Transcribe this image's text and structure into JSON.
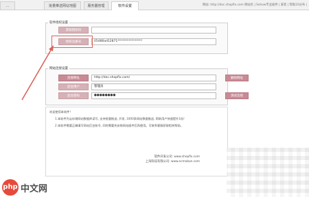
{
  "tabs": [
    {
      "label": "…",
      "active": false
    },
    {
      "label": "批量推送网站地图",
      "active": false
    },
    {
      "label": "服务器管理",
      "active": false
    },
    {
      "label": "软件设置",
      "active": true
    }
  ],
  "header_note": "网站: http://doc.shopfix.com 网站名 | Sohow专业插件 | 安装 | 帮助10分布 |",
  "auth": {
    "title": "软件授权设置",
    "get_code_label": "获取授权码",
    "register_label": "授权注册号",
    "machine_value": "",
    "code_value": "05486ad12871****************"
  },
  "site": {
    "title": "网站连接设置",
    "url_label": "连接网址",
    "user_label": "后台用户",
    "pass_label": "后台密码",
    "url_value": "http://doc.shopfix.com/",
    "user_value": "管理员",
    "pass_value": "●●●●●●●●",
    "delete_label": "删除网址",
    "test_label": "测试连接"
  },
  "notes": {
    "intro": "欢迎使用本软件!",
    "line1": "1.本软件为云存储网站数据库读写, 支持批量推送, 开发, 1000条网站数据推送, 帮助用户快速提升1倍!",
    "line2": "2.本软件需要正确填写网站后台账号, 同时需要先安装网站插件后再使用。可联系客服获取相关帮助。",
    "sign1": "软件开发公司: www.shopfix.com",
    "sign2": "上海科技有限公司: www.ecmoban.com"
  },
  "watermark": {
    "logo": "php",
    "text": "中文网"
  }
}
